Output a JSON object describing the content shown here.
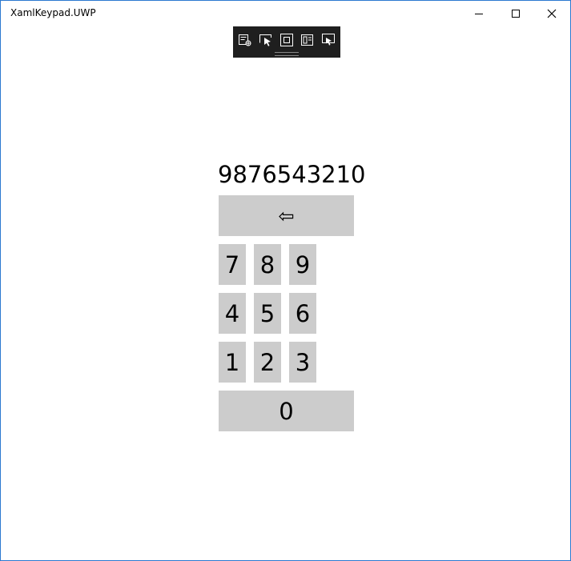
{
  "window": {
    "title": "XamlKeypad.UWP",
    "accent_border": "#2b79d0"
  },
  "caption_buttons": {
    "minimize_icon": "minimize-icon",
    "maximize_icon": "maximize-icon",
    "close_icon": "close-icon"
  },
  "dev_toolbar": {
    "tools": [
      "live-visual-tree-icon",
      "select-element-icon",
      "display-layout-adorners-icon",
      "track-focus-icon",
      "hot-reload-icon"
    ]
  },
  "keypad": {
    "display_value": "9876543210",
    "backspace_label": "⇦",
    "keys": {
      "k7": "7",
      "k8": "8",
      "k9": "9",
      "k4": "4",
      "k5": "5",
      "k6": "6",
      "k1": "1",
      "k2": "2",
      "k3": "3",
      "k0": "0"
    },
    "key_color": "#cccccc"
  }
}
